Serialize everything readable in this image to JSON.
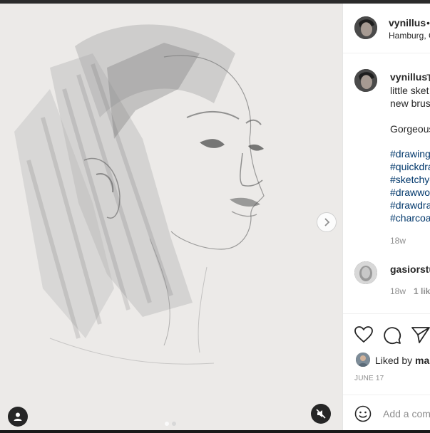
{
  "post": {
    "username": "vynillus",
    "header_dot": "•",
    "location": "Hamburg, G",
    "caption_user": "vynillus",
    "caption_lines": [
      "T",
      "little sket",
      "new brus"
    ],
    "caption_line2": "Gorgeous",
    "hashtags": [
      "#drawing",
      "#quickdra",
      "#sketchyc",
      "#drawwo",
      "#drawdra",
      "#charcoa"
    ],
    "caption_time": "18w",
    "comment_user": "gasiorstu",
    "comment_time": "18w",
    "comment_likes": "1 lik",
    "liked_by_prefix": "Liked by",
    "liked_by_user": "mar",
    "date": "JUNE 17",
    "add_comment_placeholder": "Add a com"
  },
  "carousel": {
    "current_slide": 1,
    "total_slides": 2
  },
  "icons": [
    "chevron-right-icon",
    "user-tag-icon",
    "mute-icon",
    "heart-icon",
    "comment-icon",
    "share-icon",
    "emoji-icon"
  ]
}
